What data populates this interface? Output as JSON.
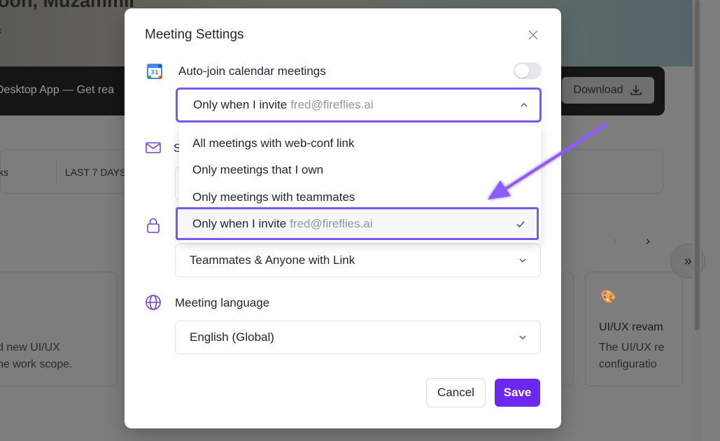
{
  "background": {
    "greeting": "rnoon, Muzammil",
    "subtitle": "k",
    "banner_text": "Desktop App — Get rea",
    "download_label": "Download",
    "filter_left": "ks",
    "filter_range": "LAST 7 DAYS",
    "card1_text": [
      "d new UI/UX",
      "he work scope."
    ],
    "card3_title": "UI/UX revam",
    "card3_text": [
      "The UI/UX re",
      "configuratio"
    ]
  },
  "modal": {
    "title": "Meeting Settings",
    "auto_join": {
      "label": "Auto-join calendar meetings",
      "calendar_day": "31",
      "toggle_on": false,
      "select_value": "Only when I invite",
      "select_email": "fred@fireflies.ai"
    },
    "dropdown_options": [
      {
        "label": "All meetings with web-conf link",
        "email": ""
      },
      {
        "label": "Only meetings that I own",
        "email": ""
      },
      {
        "label": "Only meetings with teammates",
        "email": ""
      },
      {
        "label": "Only when I invite",
        "email": "fred@fireflies.ai",
        "selected": true
      }
    ],
    "email_row_label_partial": "S",
    "access_row_label_partial": "",
    "sharing_select_value": "Teammates & Anyone with Link",
    "language": {
      "label": "Meeting language",
      "value": "English (Global)"
    },
    "cancel_label": "Cancel",
    "save_label": "Save"
  },
  "colors": {
    "accent": "#6d28f0",
    "highlight_border": "#7b55ec",
    "icon_purple": "#6d44d6"
  }
}
